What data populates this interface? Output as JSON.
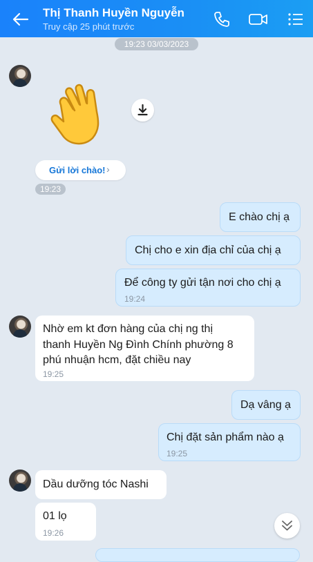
{
  "header": {
    "title": "Thị Thanh Huyền Nguyễn",
    "subtitle": "Truy cập 25 phút trước",
    "icons": [
      "back-arrow-icon",
      "phone-icon",
      "video-call-icon",
      "menu-list-icon"
    ]
  },
  "date_separator": "19:23 03/03/2023",
  "greeting": {
    "sticker": "waving-hand-sticker",
    "button_label": "Gửi lời chào!",
    "time": "19:23"
  },
  "messages": [
    {
      "direction": "out",
      "lines": [
        "E chào chị ạ"
      ],
      "time": ""
    },
    {
      "direction": "out",
      "lines": [
        "Chị cho e xin địa chỉ của chị ạ"
      ],
      "time": ""
    },
    {
      "direction": "out",
      "lines": [
        "Để công ty gửi tận nơi cho chị ạ"
      ],
      "time": "19:24"
    },
    {
      "direction": "in",
      "lines": [
        "Nhờ em kt đơn hàng của chị ng thị",
        "thanh Huyền Ng Đình Chính phường 8",
        "phú nhuận hcm, đặt chiều nay"
      ],
      "time": "19:25"
    },
    {
      "direction": "out",
      "lines": [
        "Dạ vâng ạ"
      ],
      "time": ""
    },
    {
      "direction": "out",
      "lines": [
        "Chị đặt sản phẩm nào ạ"
      ],
      "time": "19:25"
    },
    {
      "direction": "in",
      "lines": [
        "Dầu dưỡng tóc Nashi"
      ],
      "time": ""
    },
    {
      "direction": "in",
      "lines": [
        "01 lọ"
      ],
      "time": "19:26"
    }
  ]
}
